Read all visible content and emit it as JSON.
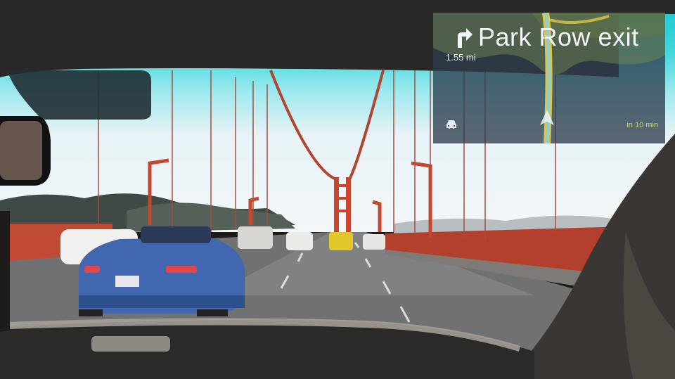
{
  "navigation": {
    "instruction": "Park Row exit",
    "distance": "1.55 mi",
    "eta": "in 10 min",
    "turn_icon": "turn-right-icon",
    "mode_icon": "car-icon",
    "accent_route_color": "#e8d34a"
  }
}
